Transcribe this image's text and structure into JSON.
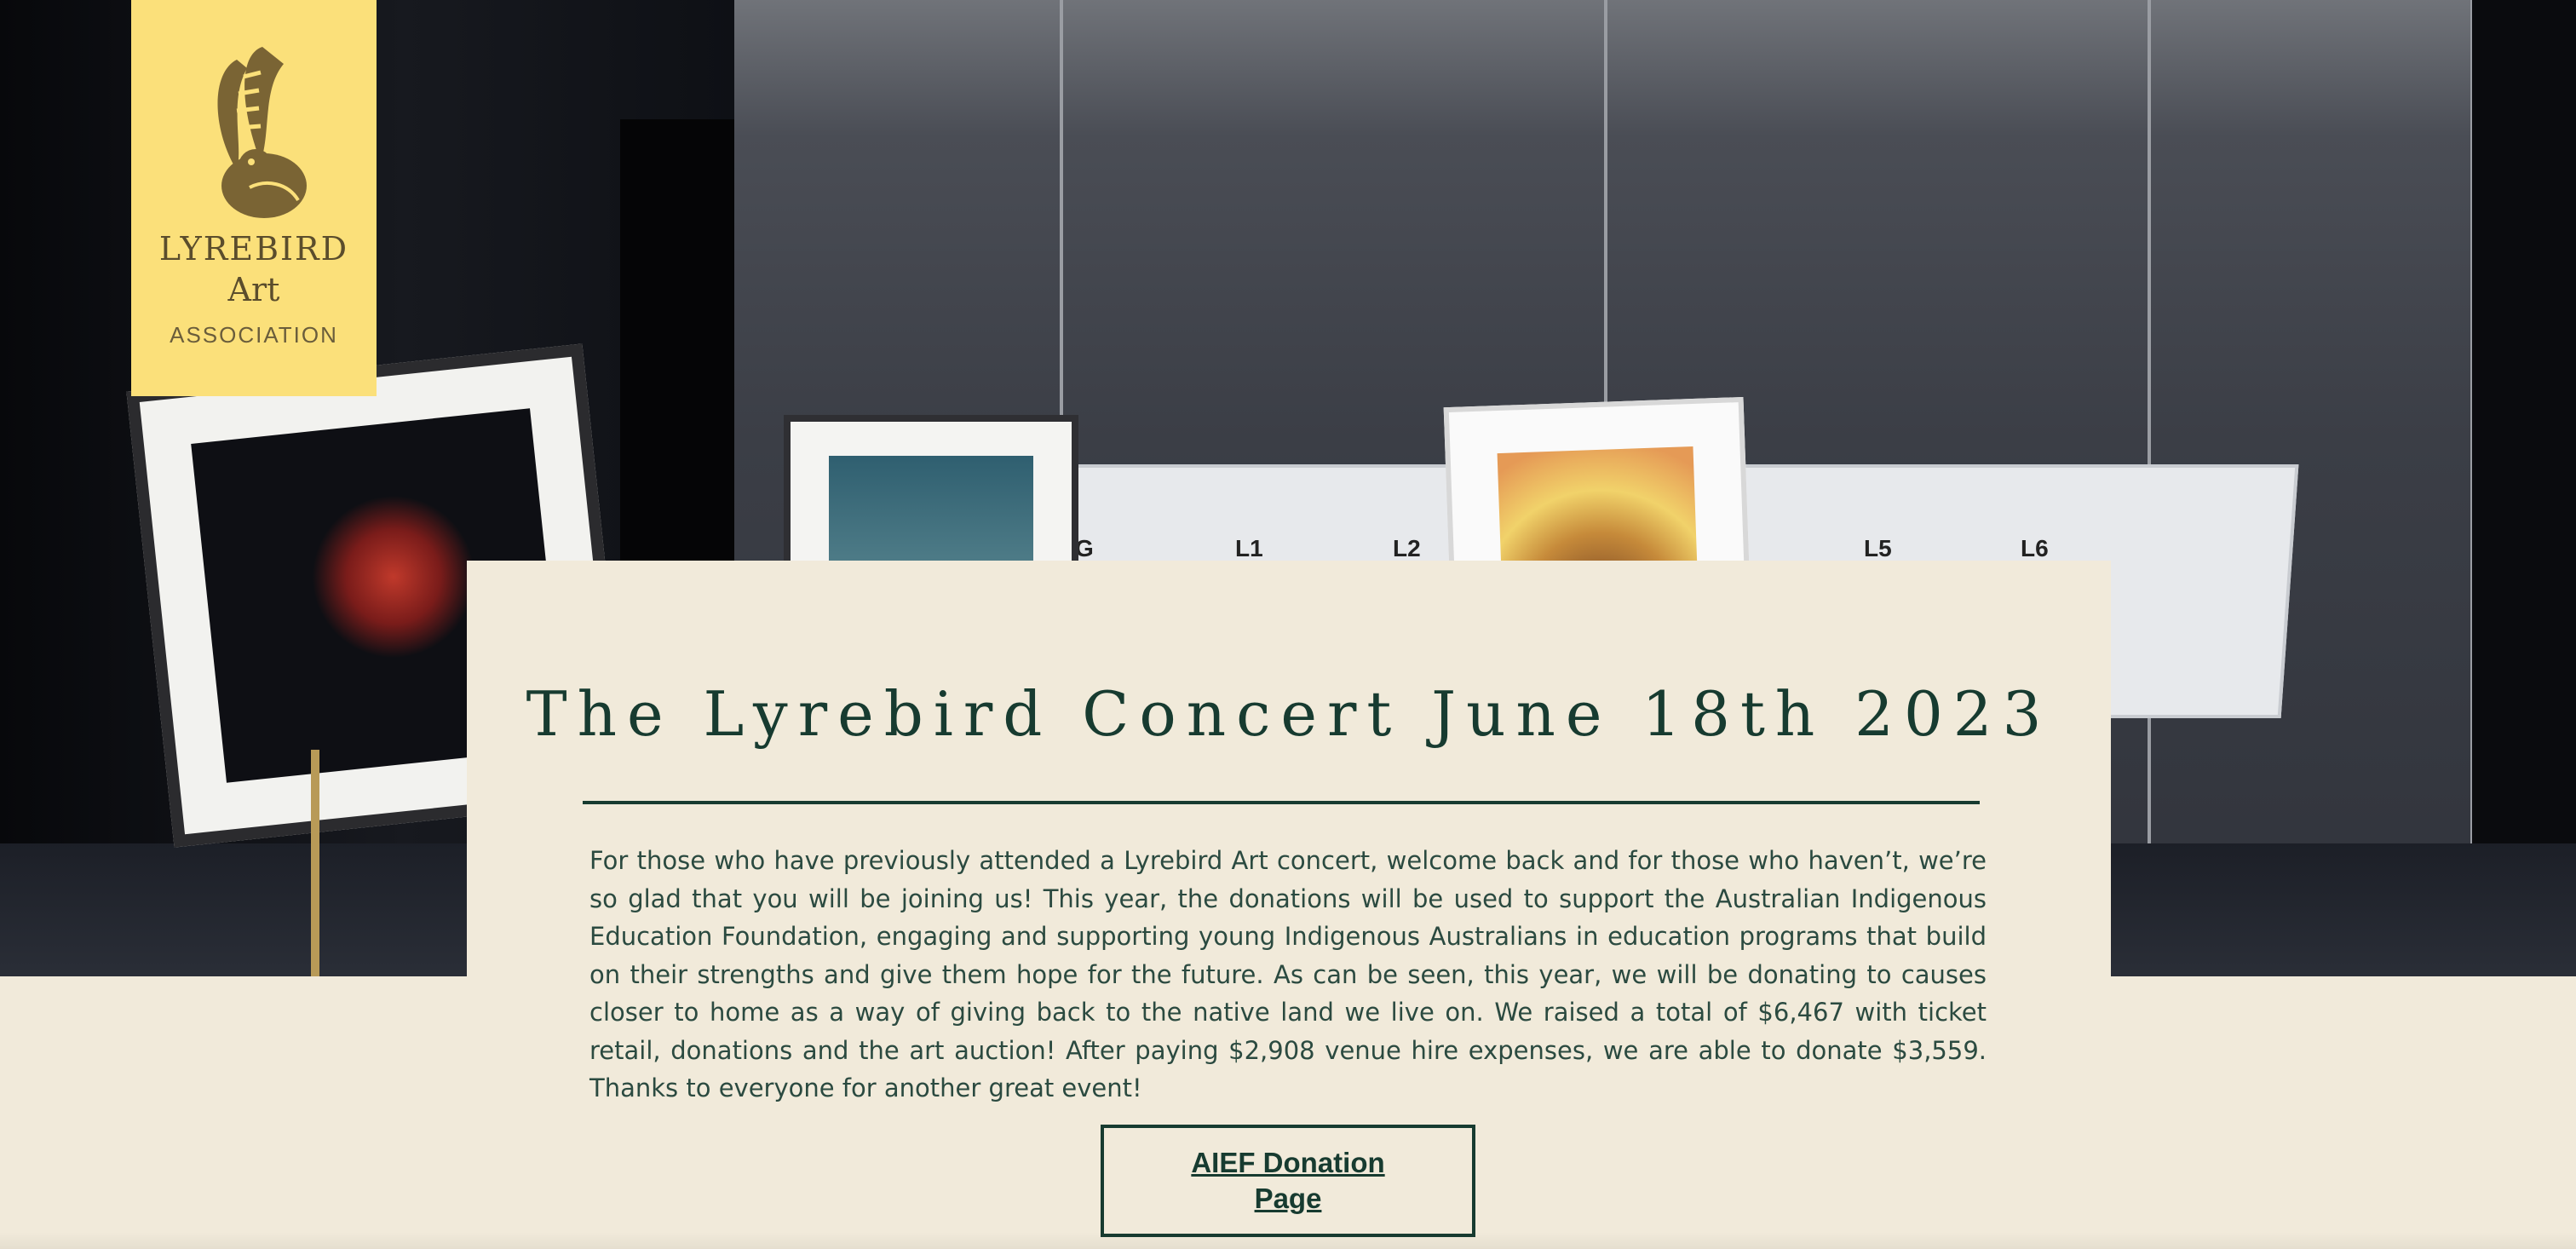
{
  "hero": {
    "sign_labels": [
      "G",
      "L1",
      "L2",
      "L5",
      "L6"
    ]
  },
  "logo": {
    "line1": "LYREBIRD",
    "line2": "Art",
    "line3": "ASSOCIATION",
    "icon": "lyrebird-icon"
  },
  "main": {
    "title": "The Lyrebird Concert June 18th 2023",
    "body": "For those who have previously attended a Lyrebird Art concert, welcome back and for those who haven’t, we’re so glad that you will be joining us! This year, the donations will be used to support the Australian Indigenous Education Foundation, engaging and supporting young Indigenous Australians in education programs that build on their strengths and give them hope for the future. As can be seen, this year, we will be donating to causes closer to home as a way of giving back to the native land we live on. We raised a total of $6,467 with ticket retail, donations and the art auction! After paying $2,908 venue hire expenses, we are able to donate $3,559. Thanks to everyone for another great event!",
    "donate_button": "AIEF Donation Page"
  },
  "colors": {
    "logo_bg": "#fbe07a",
    "card_bg": "#f1eada",
    "accent": "#173b30"
  }
}
